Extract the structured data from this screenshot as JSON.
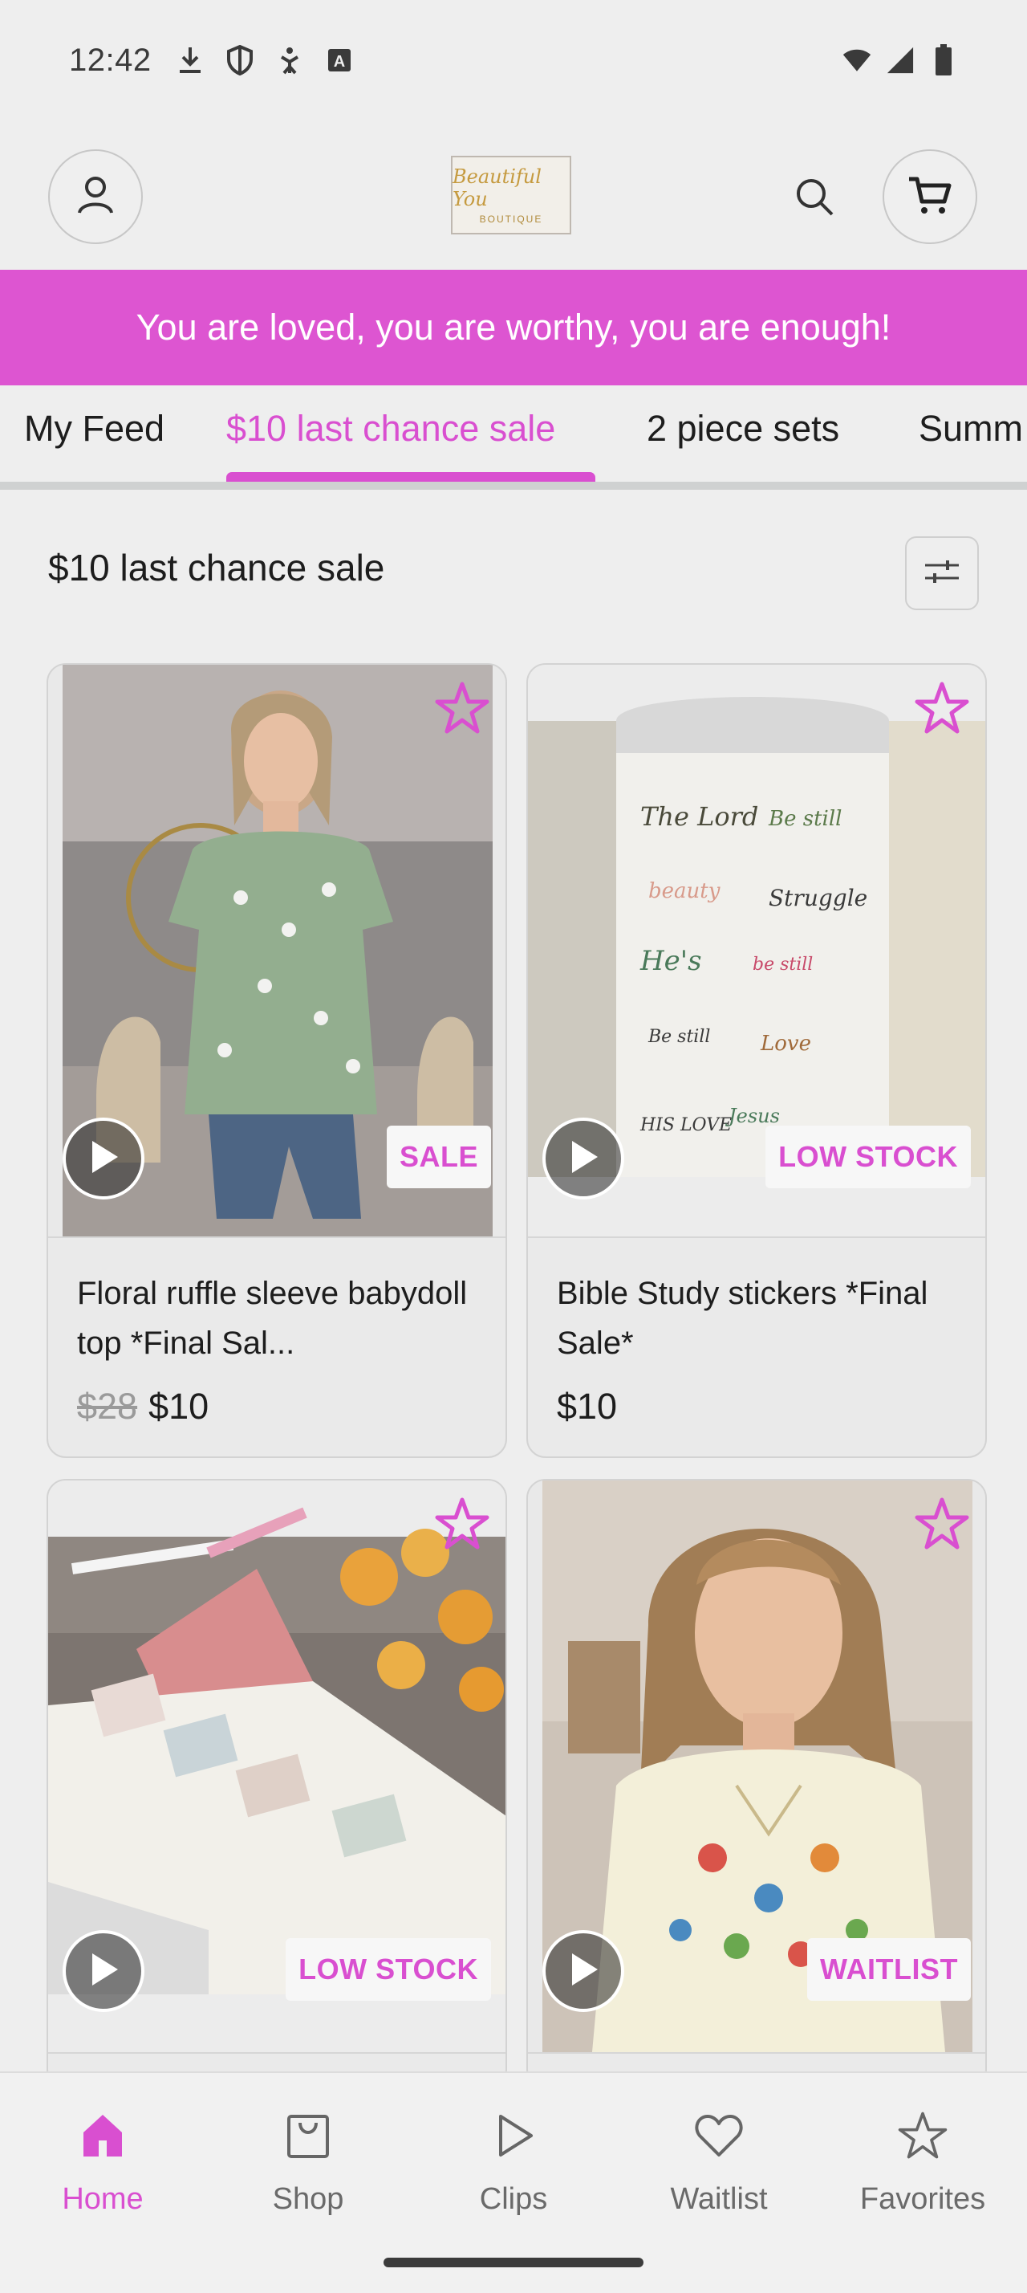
{
  "status_bar": {
    "time": "12:42",
    "left_icons": [
      "download-icon",
      "shield-icon",
      "accessibility-icon",
      "keyboard-a-icon"
    ],
    "right_icons": [
      "wifi-icon",
      "signal-icon",
      "battery-icon"
    ]
  },
  "header": {
    "logo_text": "Beautiful You",
    "logo_subtext": "BOUTIQUE",
    "icons": [
      "profile-icon",
      "search-icon",
      "cart-icon"
    ]
  },
  "banner": {
    "text": "You are loved, you are worthy, you are enough!"
  },
  "tabs": [
    {
      "label": "My Feed",
      "active": false
    },
    {
      "label": "$10 last chance sale",
      "active": true
    },
    {
      "label": "2 piece sets",
      "active": false
    },
    {
      "label": "Summ",
      "active": false
    }
  ],
  "section": {
    "title": "$10 last chance sale"
  },
  "products": [
    {
      "title": "Floral ruffle sleeve babydoll top *Final Sal...",
      "old_price": "$28",
      "price": "$10",
      "badge": "SALE"
    },
    {
      "title": "Bible Study stickers *Final Sale*",
      "old_price": "",
      "price": "$10",
      "badge": "LOW STOCK"
    },
    {
      "title": "",
      "old_price": "",
      "price": "",
      "badge": "LOW STOCK"
    },
    {
      "title": "",
      "old_price": "",
      "price": "",
      "badge": "WAITLIST"
    }
  ],
  "bottom_nav": [
    {
      "label": "Home",
      "icon": "home-icon",
      "active": true
    },
    {
      "label": "Shop",
      "icon": "shopping-bag-icon",
      "active": false
    },
    {
      "label": "Clips",
      "icon": "play-icon",
      "active": false
    },
    {
      "label": "Waitlist",
      "icon": "heart-icon",
      "active": false
    },
    {
      "label": "Favorites",
      "icon": "star-icon",
      "active": false
    }
  ],
  "colors": {
    "accent": "#d94fd0",
    "banner": "#dd55d1",
    "background": "#eeeeee"
  }
}
